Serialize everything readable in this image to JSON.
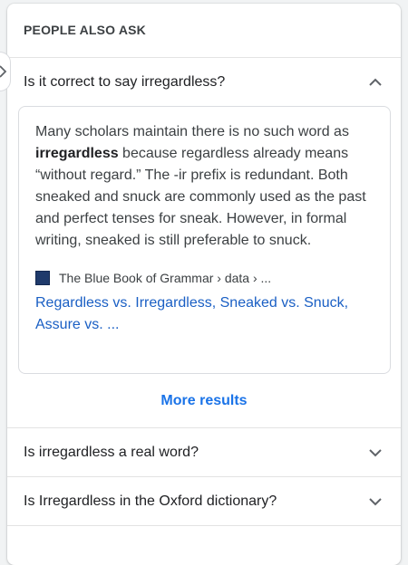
{
  "header": {
    "title": "PEOPLE ALSO ASK"
  },
  "questions": [
    {
      "text": "Is it correct to say irregardless?",
      "expanded": true,
      "icon": "chevron-up-icon"
    },
    {
      "text": "Is irregardless a real word?",
      "expanded": false,
      "icon": "chevron-down-icon"
    },
    {
      "text": "Is Irregardless in the Oxford dictionary?",
      "expanded": false,
      "icon": "chevron-down-icon"
    }
  ],
  "answer": {
    "text_before_bold": "Many scholars maintain there is no such word as ",
    "bold": "irregardless",
    "text_after_bold": " because regardless already means “without regard.” The -ir prefix is redundant. Both sneaked and snuck are commonly used as the past and perfect tenses for sneak. However, in formal writing, sneaked is still preferable to snuck.",
    "source_name": "The Blue Book of Grammar › data › ...",
    "source_icon": "favicon-bluebook",
    "link_text": "Regardless vs. Irregardless, Sneaked vs. Snuck, Assure vs. ..."
  },
  "more_results_label": "More results",
  "colors": {
    "link": "#1a5fc4",
    "more_results": "#1a73e8",
    "favicon": "#1f3a6b",
    "border": "#dadce0"
  }
}
